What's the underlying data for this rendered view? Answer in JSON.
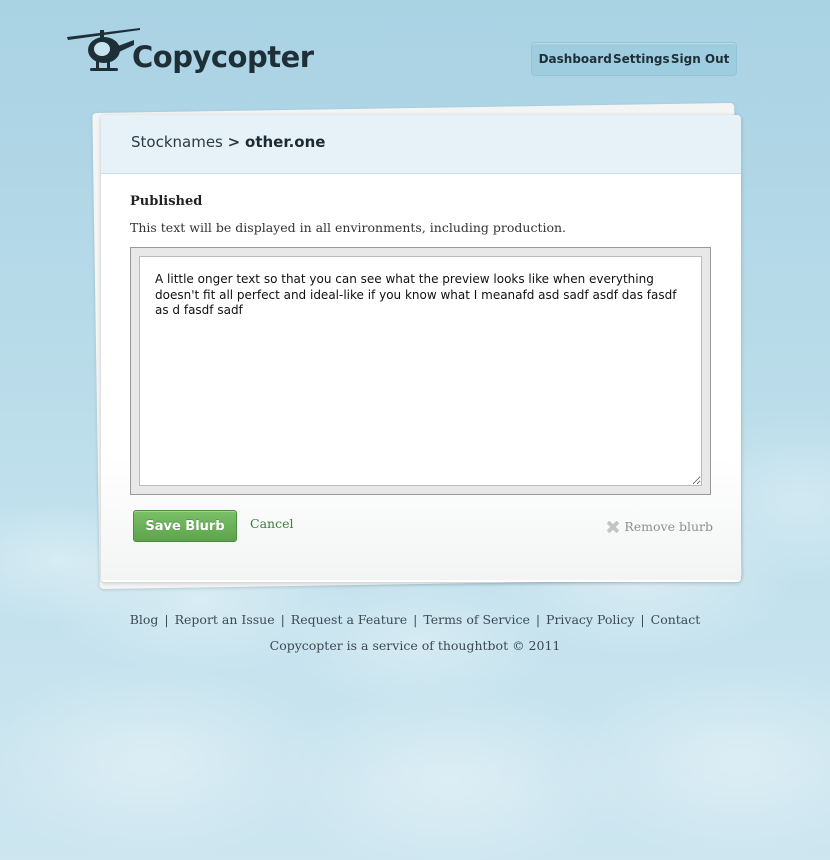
{
  "app": {
    "name": "Copycopter"
  },
  "nav": {
    "items": [
      {
        "label": "Dashboard"
      },
      {
        "label": "Settings"
      },
      {
        "label": "Sign Out"
      }
    ]
  },
  "breadcrumb": {
    "project": "Stocknames",
    "separator": ">",
    "key": "other.one"
  },
  "blurb": {
    "status": "Published",
    "hint": "This text will be displayed in all environments, including production.",
    "content": "A little onger text so that you can see what the preview looks like when everything doesn't fit all perfect and ideal-like if you know what I meanafd asd sadf asdf das fasdf  as d fasdf sadf"
  },
  "actions": {
    "save_label": "Save Blurb",
    "cancel_label": "Cancel",
    "remove_label": "Remove blurb"
  },
  "footer": {
    "links": [
      {
        "label": "Blog"
      },
      {
        "label": "Report an Issue"
      },
      {
        "label": "Request a Feature"
      },
      {
        "label": "Terms of Service"
      },
      {
        "label": "Privacy Policy"
      },
      {
        "label": "Contact"
      }
    ],
    "note": "Copycopter is a service of thoughtbot © 2011"
  },
  "colors": {
    "background": "#b4d9e8",
    "nav_bg": "#9fcde0",
    "save_button": "#6cb35a",
    "cancel_link": "#3e7d34",
    "text_dark": "#1f2f38"
  },
  "icons": {
    "logo": "helicopter-icon",
    "remove": "x-icon"
  }
}
